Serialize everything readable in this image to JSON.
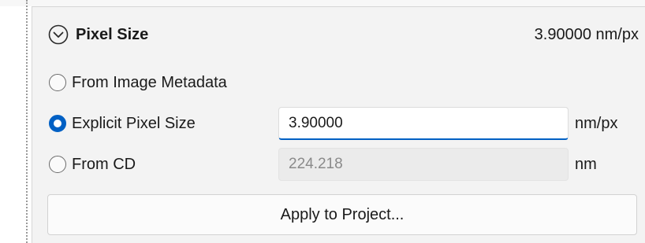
{
  "panel": {
    "header": {
      "title": "Pixel Size",
      "value": "3.90000 nm/px",
      "icon": "chevron-circle-down-icon"
    },
    "options": [
      {
        "label": "From Image Metadata",
        "selected": false
      },
      {
        "label": "Explicit Pixel Size",
        "selected": true,
        "field_value": "3.90000",
        "unit": "nm/px",
        "field_state": "focused"
      },
      {
        "label": "From CD",
        "selected": false,
        "field_value": "224.218",
        "unit": "nm",
        "field_state": "disabled"
      }
    ],
    "apply_button_label": "Apply to Project..."
  },
  "colors": {
    "accent": "#0060c4",
    "panel_background": "#f3f3f3",
    "disabled_field_background": "#ebebeb"
  }
}
